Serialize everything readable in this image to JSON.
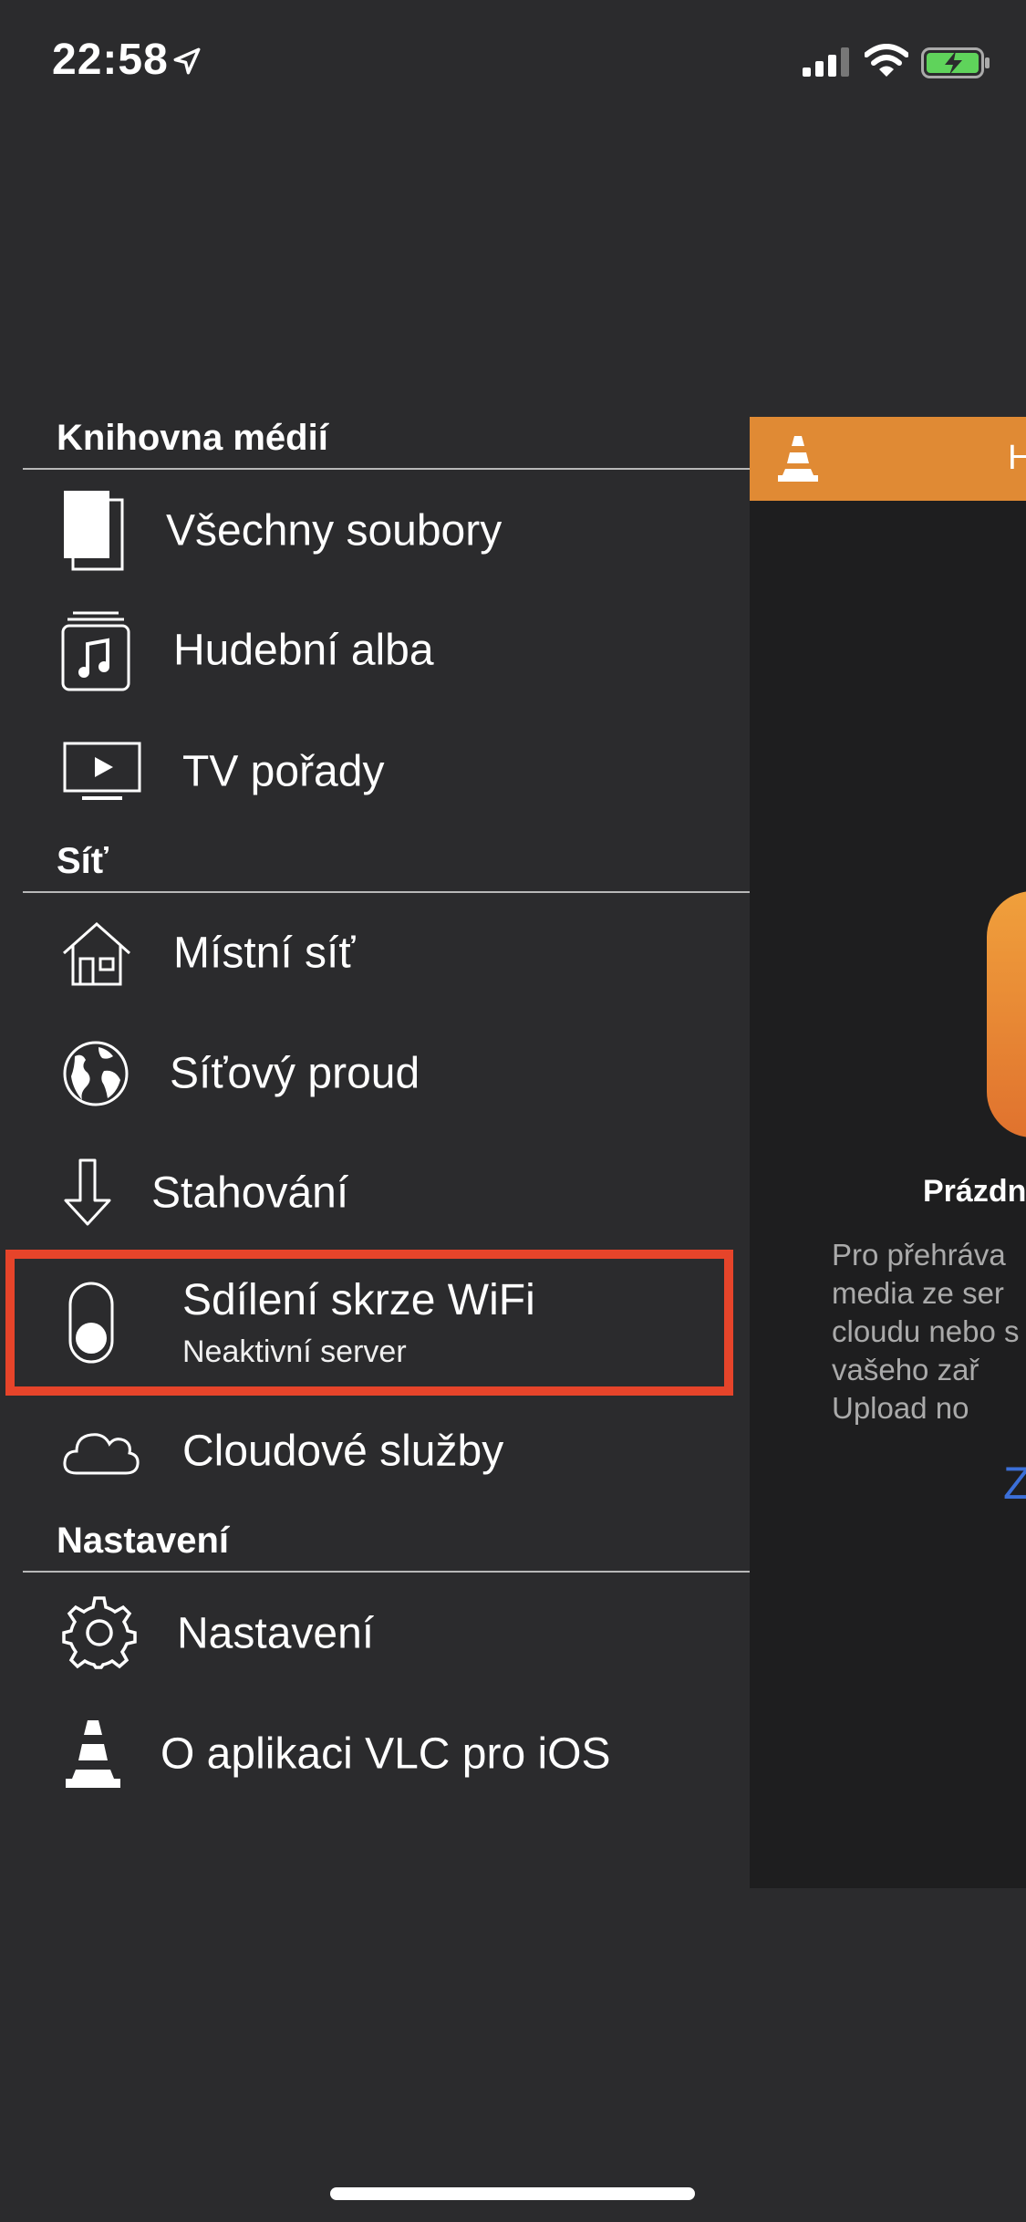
{
  "status_bar": {
    "time": "22:58",
    "icons": [
      "location-arrow-icon",
      "cellular-signal-icon",
      "wifi-icon",
      "battery-charging-icon"
    ],
    "battery_color": "#5fd35b"
  },
  "menu": {
    "sections": [
      {
        "header": "Knihovna médií"
      },
      {
        "header": "Síť"
      },
      {
        "header": "Nastavení"
      }
    ],
    "items": {
      "all_files": {
        "label": "Všechny soubory",
        "icon": "document-icon"
      },
      "music_albums": {
        "label": "Hudební alba",
        "icon": "music-album-icon"
      },
      "tv_shows": {
        "label": "TV pořady",
        "icon": "tv-icon"
      },
      "local_network": {
        "label": "Místní síť",
        "icon": "house-icon"
      },
      "network_stream": {
        "label": "Síťový proud",
        "icon": "globe-icon"
      },
      "downloads": {
        "label": "Stahování",
        "icon": "download-arrow-icon"
      },
      "wifi_sharing": {
        "label": "Sdílení skrze WiFi",
        "sublabel": "Neaktivní server",
        "icon": "toggle-icon"
      },
      "cloud_services": {
        "label": "Cloudové služby",
        "icon": "cloud-icon"
      },
      "settings": {
        "label": "Nastavení",
        "icon": "gear-icon"
      },
      "about": {
        "label": "O aplikaci VLC pro iOS",
        "icon": "vlc-cone-icon"
      }
    },
    "highlight_color": "#e6442a"
  },
  "main": {
    "nav_title": "H",
    "empty_title": "Prázdn",
    "empty_desc": "Pro přehráva\nmedia ze ser\ncloudu nebo s\nvašeho zař\nUpload no",
    "link_text": "Z",
    "accent_color": "#e08a34"
  }
}
